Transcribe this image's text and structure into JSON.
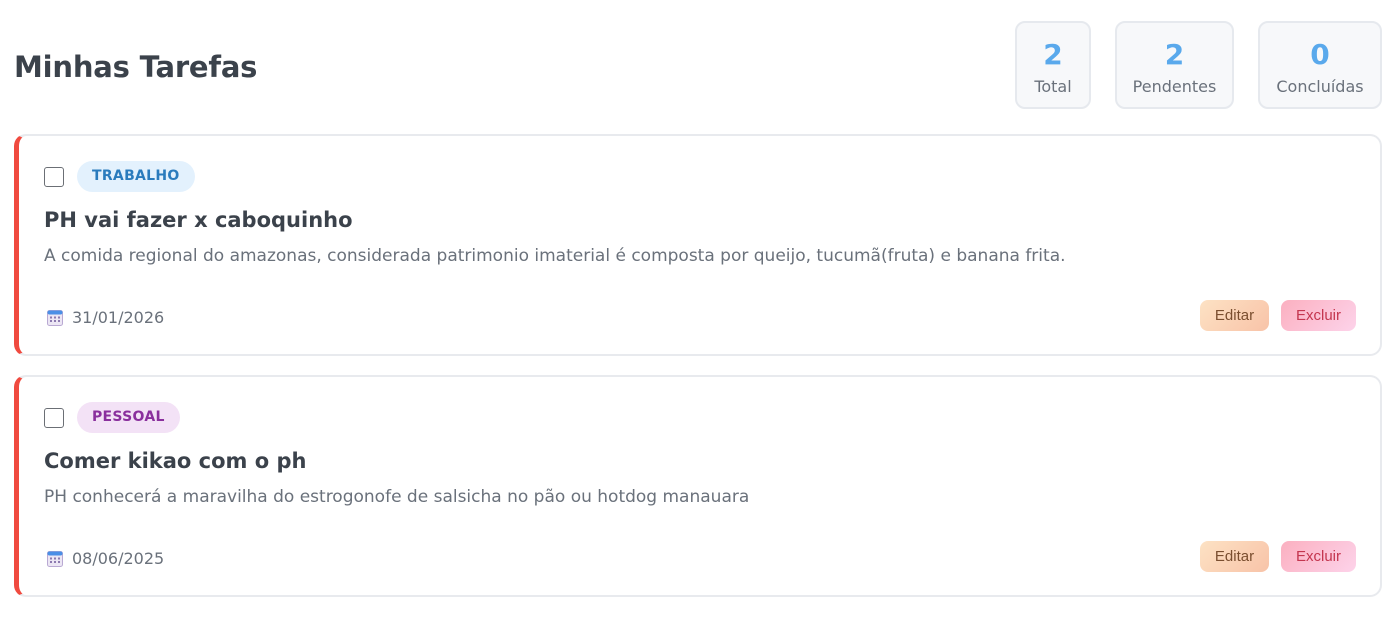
{
  "header": {
    "title": "Minhas Tarefas"
  },
  "stats": {
    "total": {
      "value": "2",
      "label": "Total"
    },
    "pending": {
      "value": "2",
      "label": "Pendentes"
    },
    "done": {
      "value": "0",
      "label": "Concluídas"
    }
  },
  "tasks": [
    {
      "completed": false,
      "category": "TRABALHO",
      "title": "PH vai fazer x caboquinho",
      "description": "A comida regional do amazonas, considerada patrimonio imaterial é composta por queijo, tucumã(fruta) e banana frita.",
      "date": "31/01/2026",
      "date_icon": "calendar-icon",
      "edit_label": "Editar",
      "delete_label": "Excluir"
    },
    {
      "completed": false,
      "category": "PESSOAL",
      "title": "Comer kikao com o ph",
      "description": "PH conhecerá a maravilha do estrogonofe de salsicha no pão ou hotdog manauara",
      "date": "08/06/2025",
      "date_icon": "calendar-icon",
      "edit_label": "Editar",
      "delete_label": "Excluir"
    }
  ],
  "colors": {
    "accent": "#5aa9ec",
    "priority_border": "#f04a3f",
    "trabalho_badge_bg": "#e3f1fd",
    "trabalho_badge_text": "#2a7bbd",
    "pessoal_badge_bg": "#f3e2f6",
    "pessoal_badge_text": "#8a2f9d"
  }
}
